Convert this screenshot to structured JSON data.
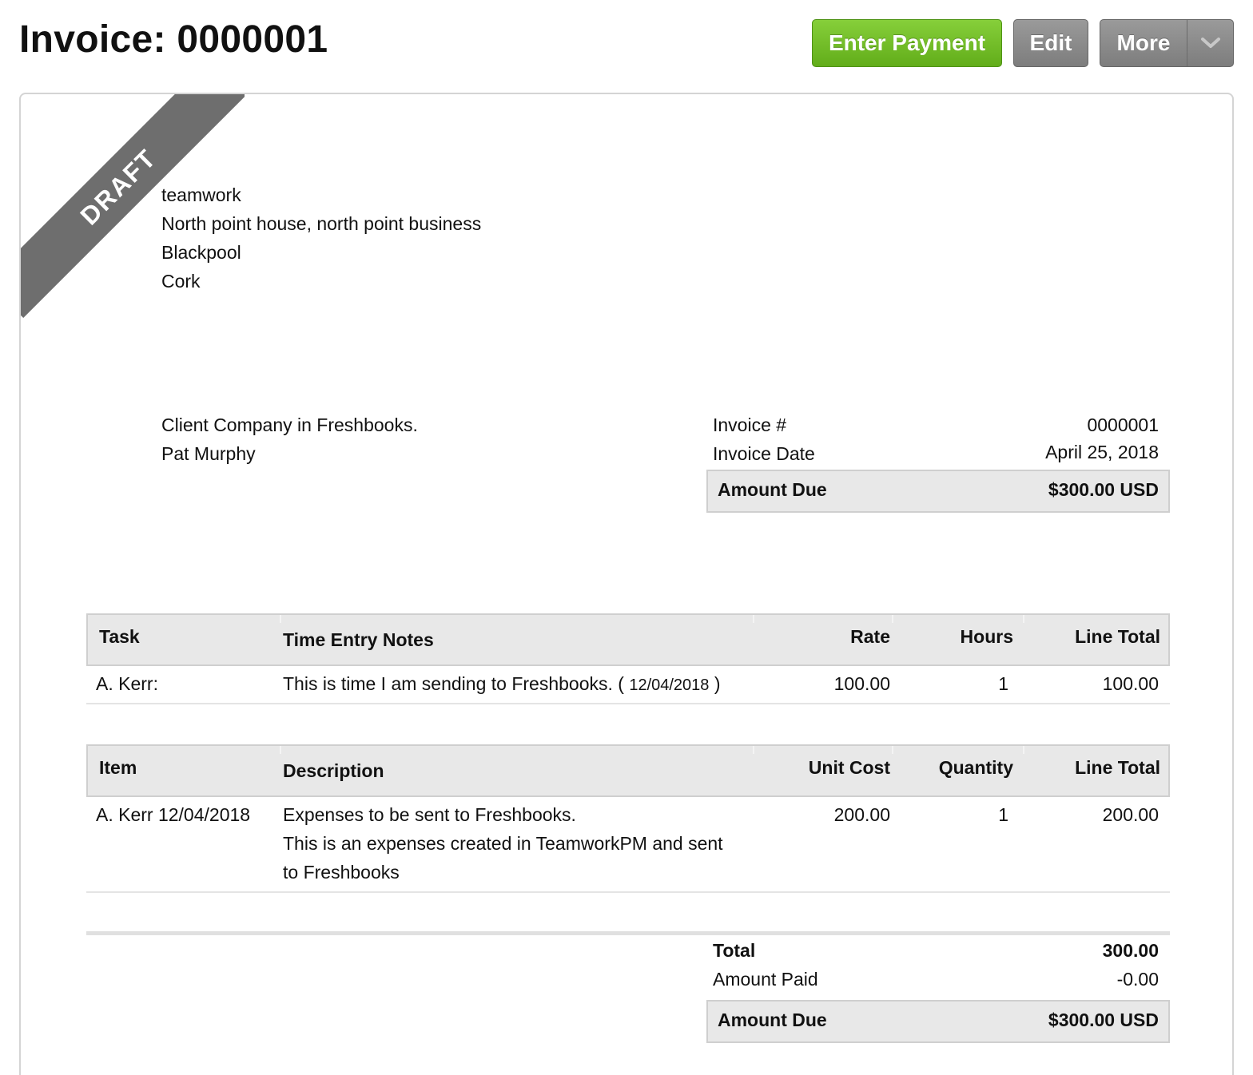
{
  "header": {
    "title": "Invoice: 0000001",
    "buttons": {
      "enter_payment": "Enter Payment",
      "edit": "Edit",
      "more": "More"
    }
  },
  "colors": {
    "primary_button": "#6cb823",
    "secondary_button": "#8a8a8a",
    "ribbon": "#6e6e6e",
    "table_header_bg": "#e8e8e8"
  },
  "status_ribbon": "DRAFT",
  "sender": {
    "name": "teamwork",
    "address_line1": "North point house, north point business",
    "address_line2": "Blackpool",
    "address_line3": "Cork"
  },
  "client": {
    "company": "Client Company in Freshbooks.",
    "contact": "Pat Murphy"
  },
  "invoice_meta": {
    "number_label": "Invoice #",
    "number": "0000001",
    "date_label": "Invoice Date",
    "date": "April 25, 2018",
    "amount_due_label": "Amount Due",
    "amount_due": "$300.00 USD"
  },
  "time_table": {
    "headers": {
      "task": "Task",
      "notes": "Time Entry Notes",
      "rate": "Rate",
      "hours": "Hours",
      "line_total": "Line Total"
    },
    "rows": [
      {
        "task": "A. Kerr:",
        "notes": "This is time I am sending to Freshbooks. (",
        "notes_date": "12/04/2018",
        "notes_close": ")",
        "rate": "100.00",
        "hours": "1",
        "line_total": "100.00"
      }
    ]
  },
  "expense_table": {
    "headers": {
      "item": "Item",
      "description": "Description",
      "unit_cost": "Unit Cost",
      "quantity": "Quantity",
      "line_total": "Line Total"
    },
    "rows": [
      {
        "item": "A. Kerr 12/04/2018",
        "description_line1": "Expenses to be sent to Freshbooks.",
        "description_line2": "This is an expenses created in TeamworkPM and sent",
        "description_line3": "to Freshbooks",
        "unit_cost": "200.00",
        "quantity": "1",
        "line_total": "200.00"
      }
    ]
  },
  "totals": {
    "total_label": "Total",
    "total": "300.00",
    "paid_label": "Amount Paid",
    "paid": "-0.00",
    "amount_due_label": "Amount Due",
    "amount_due": "$300.00 USD"
  }
}
